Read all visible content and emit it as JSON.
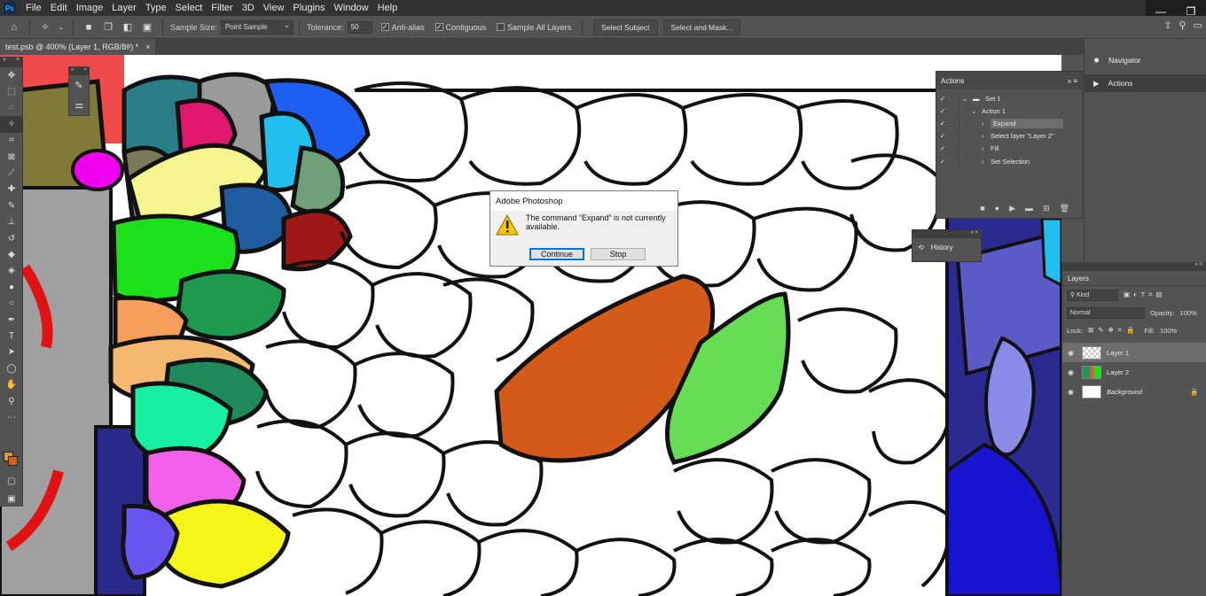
{
  "app": {
    "logo_text": "Ps"
  },
  "menu": [
    "File",
    "Edit",
    "Image",
    "Layer",
    "Type",
    "Select",
    "Filter",
    "3D",
    "View",
    "Plugins",
    "Window",
    "Help"
  ],
  "window_controls": {
    "minimize": "—",
    "maximize": "❐",
    "close": "✕"
  },
  "options": {
    "sample_size_label": "Sample Size:",
    "sample_size_value": "Point Sample",
    "tolerance_label": "Tolerance:",
    "tolerance_value": "50",
    "anti_alias_label": "Anti-alias",
    "contiguous_label": "Contiguous",
    "sample_all_layers_label": "Sample All Layers",
    "select_subject_label": "Select Subject",
    "select_and_mask_label": "Select and Mask..."
  },
  "document": {
    "tab_title": "test.psb @ 400% (Layer 1, RGB/8#) *",
    "close": "×"
  },
  "actions_panel": {
    "title": "Actions",
    "rows": [
      {
        "label": "Set 1",
        "indent": 0,
        "type": "set"
      },
      {
        "label": "Action 1",
        "indent": 1,
        "type": "action"
      },
      {
        "label": "Expand",
        "indent": 2,
        "type": "step",
        "selected": true
      },
      {
        "label": "Select layer \"Layer 2\"",
        "indent": 2,
        "type": "step"
      },
      {
        "label": "Fill",
        "indent": 2,
        "type": "step"
      },
      {
        "label": "Set Selection",
        "indent": 2,
        "type": "step"
      }
    ]
  },
  "history_panel": {
    "title": "History"
  },
  "right_panels": {
    "navigator": "Navigator",
    "actions": "Actions"
  },
  "layers_panel": {
    "title": "Layers",
    "kind_label": "Kind",
    "blend_mode": "Normal",
    "opacity_label": "Opacity:",
    "opacity_value": "100%",
    "lock_label": "Lock:",
    "fill_label": "Fill:",
    "fill_value": "100%",
    "layers": [
      {
        "name": "Layer 1",
        "selected": true
      },
      {
        "name": "Layer 2",
        "selected": false
      },
      {
        "name": "Background",
        "selected": false,
        "locked": true
      }
    ]
  },
  "dialog": {
    "title": "Adobe Photoshop",
    "message": "The command “Expand” is not currently available.",
    "continue_label": "Continue",
    "stop_label": "Stop"
  },
  "colors": {
    "foreground": "#d4a02f",
    "background": "#d06020",
    "accent": "#0078d7"
  }
}
